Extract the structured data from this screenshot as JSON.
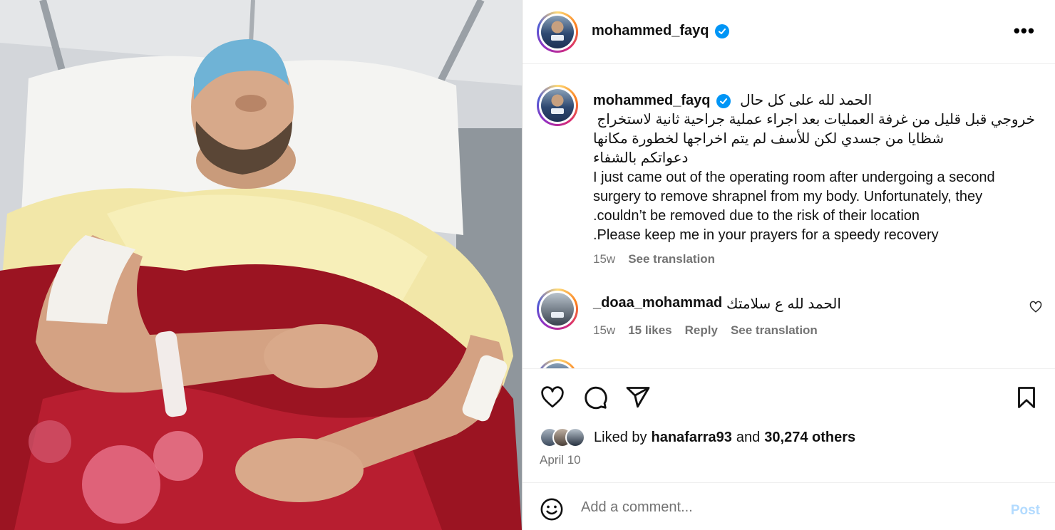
{
  "post": {
    "author": "mohammed_fayq",
    "verified_icon": "verified-badge-icon",
    "more_icon": "more-options-icon"
  },
  "caption": {
    "author": "mohammed_fayq",
    "line1": "الحمد لله على كل حال",
    "line2": "خروجي قبل قليل من غرفة العمليات بعد اجراء عملية جراحية ثانية لاستخراج",
    "line3": "شظايا من جسدي لكن للأسف لم يتم اخراجها لخطورة مكانها",
    "line4": "دعواتكم بالشفاء",
    "line5": "I just came out of the operating room after undergoing a second",
    "line6": "surgery to remove shrapnel from my body. Unfortunately, they",
    "line7": ".couldn’t be removed due to the risk of their location",
    "line8": ".Please keep me in your prayers for a speedy recovery",
    "time": "15w",
    "see_translation": "See translation"
  },
  "comments": [
    {
      "user": "_doaa_mohammad",
      "text": "الحمد لله ع سلامتك",
      "time": "15w",
      "likes": "15 likes",
      "reply": "Reply",
      "see_translation": "See translation"
    }
  ],
  "actions": {
    "like_icon": "heart-icon",
    "comment_icon": "comment-icon",
    "share_icon": "share-icon",
    "save_icon": "bookmark-icon"
  },
  "likes": {
    "prefix": "Liked by",
    "user": "hanafarra93",
    "and": "and",
    "others": "30,274 others"
  },
  "date": "April 10",
  "add_comment": {
    "placeholder": "Add a comment...",
    "post_label": "Post",
    "emoji_icon": "emoji-icon"
  },
  "colors": {
    "verified": "#0095f6",
    "muted": "#737373",
    "post_disabled": "#b3dbff"
  }
}
